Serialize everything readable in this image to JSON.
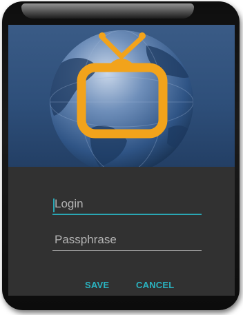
{
  "dialog": {
    "logo": {
      "icon": "tv-globe-logo-icon",
      "colors": {
        "tv": "#f2a31b",
        "globe": "#2d4f7d",
        "background": "#365780"
      }
    },
    "login": {
      "placeholder": "Login",
      "value": ""
    },
    "passphrase": {
      "placeholder": "Passphrase",
      "value": ""
    },
    "buttons": {
      "save": "SAVE",
      "cancel": "CANCEL"
    },
    "colors": {
      "accent": "#2aa7b4",
      "surface": "#313131",
      "text_hint": "#b3b3b3"
    }
  }
}
